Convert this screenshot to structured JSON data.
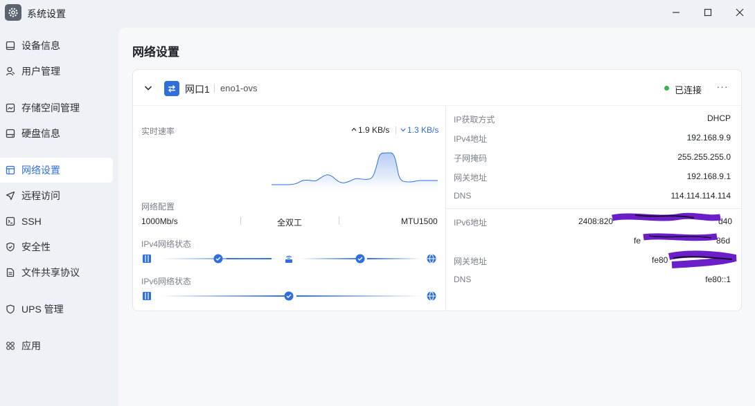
{
  "window": {
    "title": "系统设置",
    "icon": "gear-icon",
    "controls": [
      "minimize-icon",
      "maximize-icon",
      "close-icon"
    ]
  },
  "sidebar": {
    "items": [
      {
        "label": "设备信息",
        "icon": "device-icon"
      },
      {
        "label": "用户管理",
        "icon": "user-icon"
      },
      {
        "label": "存储空间管理",
        "icon": "storage-icon"
      },
      {
        "label": "硬盘信息",
        "icon": "disk-icon"
      },
      {
        "label": "网络设置",
        "icon": "network-icon",
        "active": true
      },
      {
        "label": "远程访问",
        "icon": "send-icon"
      },
      {
        "label": "SSH",
        "icon": "terminal-icon"
      },
      {
        "label": "安全性",
        "icon": "shield-icon"
      },
      {
        "label": "文件共享协议",
        "icon": "file-icon"
      },
      {
        "label": "UPS 管理",
        "icon": "ups-shield-icon"
      },
      {
        "label": "应用",
        "icon": "apps-icon"
      }
    ]
  },
  "main": {
    "title": "网络设置",
    "card": {
      "port_name": "网口1",
      "device": "eno1-ovs",
      "status": "已连接",
      "status_color": "#3bb54a",
      "more": "···",
      "speed": {
        "label": "实时速率",
        "up": "1.9 KB/s",
        "down": "1.3 KB/s"
      },
      "config": {
        "label": "网络配置",
        "speed": "1000Mb/s",
        "duplex": "全双工",
        "mtu": "MTU1500"
      },
      "ipv4_status_label": "IPv4网络状态",
      "ipv6_status_label": "IPv6网络状态",
      "info": [
        {
          "key": "IP获取方式",
          "value": "DHCP"
        },
        {
          "key": "IPv4地址",
          "value": "192.168.9.9"
        },
        {
          "key": "子网掩码",
          "value": "255.255.255.0"
        },
        {
          "key": "网关地址",
          "value": "192.168.9.1"
        },
        {
          "key": "DNS",
          "value": "114.114.114.114"
        }
      ],
      "ipv6": {
        "addr_key": "IPv6地址",
        "addr_1": "2408:820",
        "addr_1_tail": "d40",
        "addr_2": "fe",
        "addr_2_tail": "86d",
        "gateway_key": "网关地址",
        "gateway_value": "fe80",
        "dns_key": "DNS",
        "dns_value": "fe80::1"
      }
    }
  },
  "colors": {
    "accent": "#2f6fdc",
    "redaction": "#6a1fc8"
  }
}
